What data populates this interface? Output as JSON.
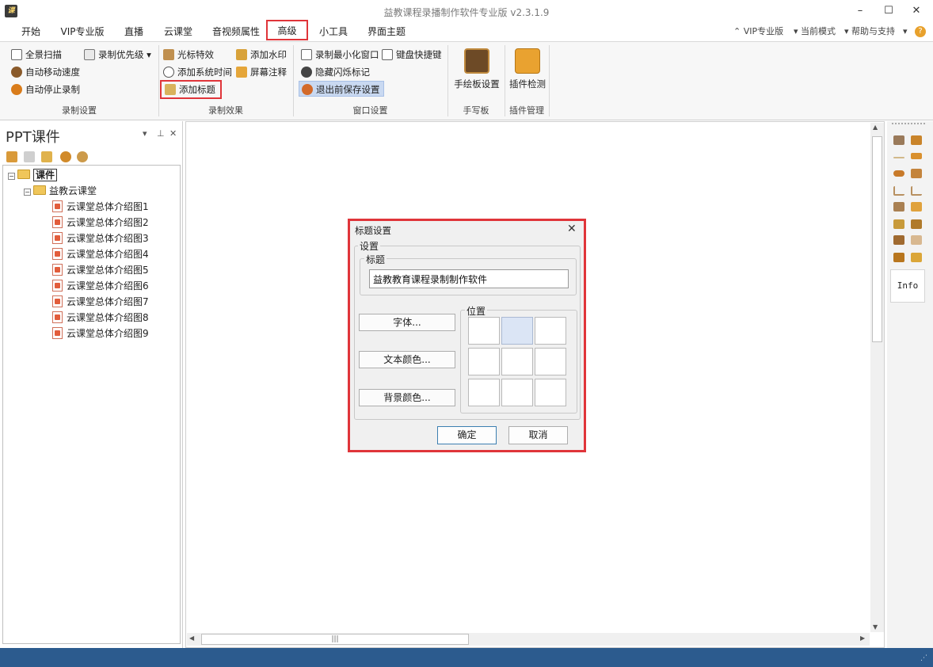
{
  "window": {
    "logo_text": "课",
    "title": "益教课程录播制作软件专业版 v2.3.1.9"
  },
  "menu": {
    "items": [
      "开始",
      "VIP专业版",
      "直播",
      "云课堂",
      "音视频属性",
      "高级",
      "小工具",
      "界面主题"
    ],
    "active": "高级",
    "right": [
      "VIP专业版",
      "当前模式",
      "帮助与支持"
    ]
  },
  "ribbon": {
    "recording_settings": {
      "items": [
        "全景扫描",
        "录制优先级",
        "自动移动速度",
        "自动停止录制"
      ],
      "label": "录制设置"
    },
    "recording_effects": {
      "items": [
        "光标特效",
        "添加水印",
        "添加系统时间",
        "屏幕注释",
        "添加标题"
      ],
      "label": "录制效果"
    },
    "window_settings": {
      "items": [
        "录制最小化窗口",
        "键盘快捷键",
        "隐藏闪烁标记",
        "退出前保存设置"
      ],
      "label": "窗口设置"
    },
    "handwriting": {
      "button": "手绘板设置",
      "label": "手写板"
    },
    "plugins": {
      "button": "插件检测",
      "label": "插件管理"
    }
  },
  "left_panel": {
    "title": "PPT课件",
    "tree": {
      "root": "课件",
      "folder": "益教云课堂",
      "files": [
        "云课堂总体介绍图1",
        "云课堂总体介绍图2",
        "云课堂总体介绍图3",
        "云课堂总体介绍图4",
        "云课堂总体介绍图5",
        "云课堂总体介绍图6",
        "云课堂总体介绍图7",
        "云课堂总体介绍图8",
        "云课堂总体介绍图9"
      ]
    }
  },
  "right_toolbar": {
    "info_label": "Info"
  },
  "dialog": {
    "title": "标题设置",
    "settings_group": "设置",
    "title_group": "标题",
    "title_value": "益教教育课程录制制作软件",
    "font_button": "字体...",
    "text_color_button": "文本颜色...",
    "bg_color_button": "背景颜色...",
    "position_group": "位置",
    "ok_button": "确定",
    "cancel_button": "取消"
  },
  "colors": {
    "highlight": "#e0353a",
    "statusbar": "#2c5b8e",
    "selected_cell": "#dbe5f5"
  }
}
